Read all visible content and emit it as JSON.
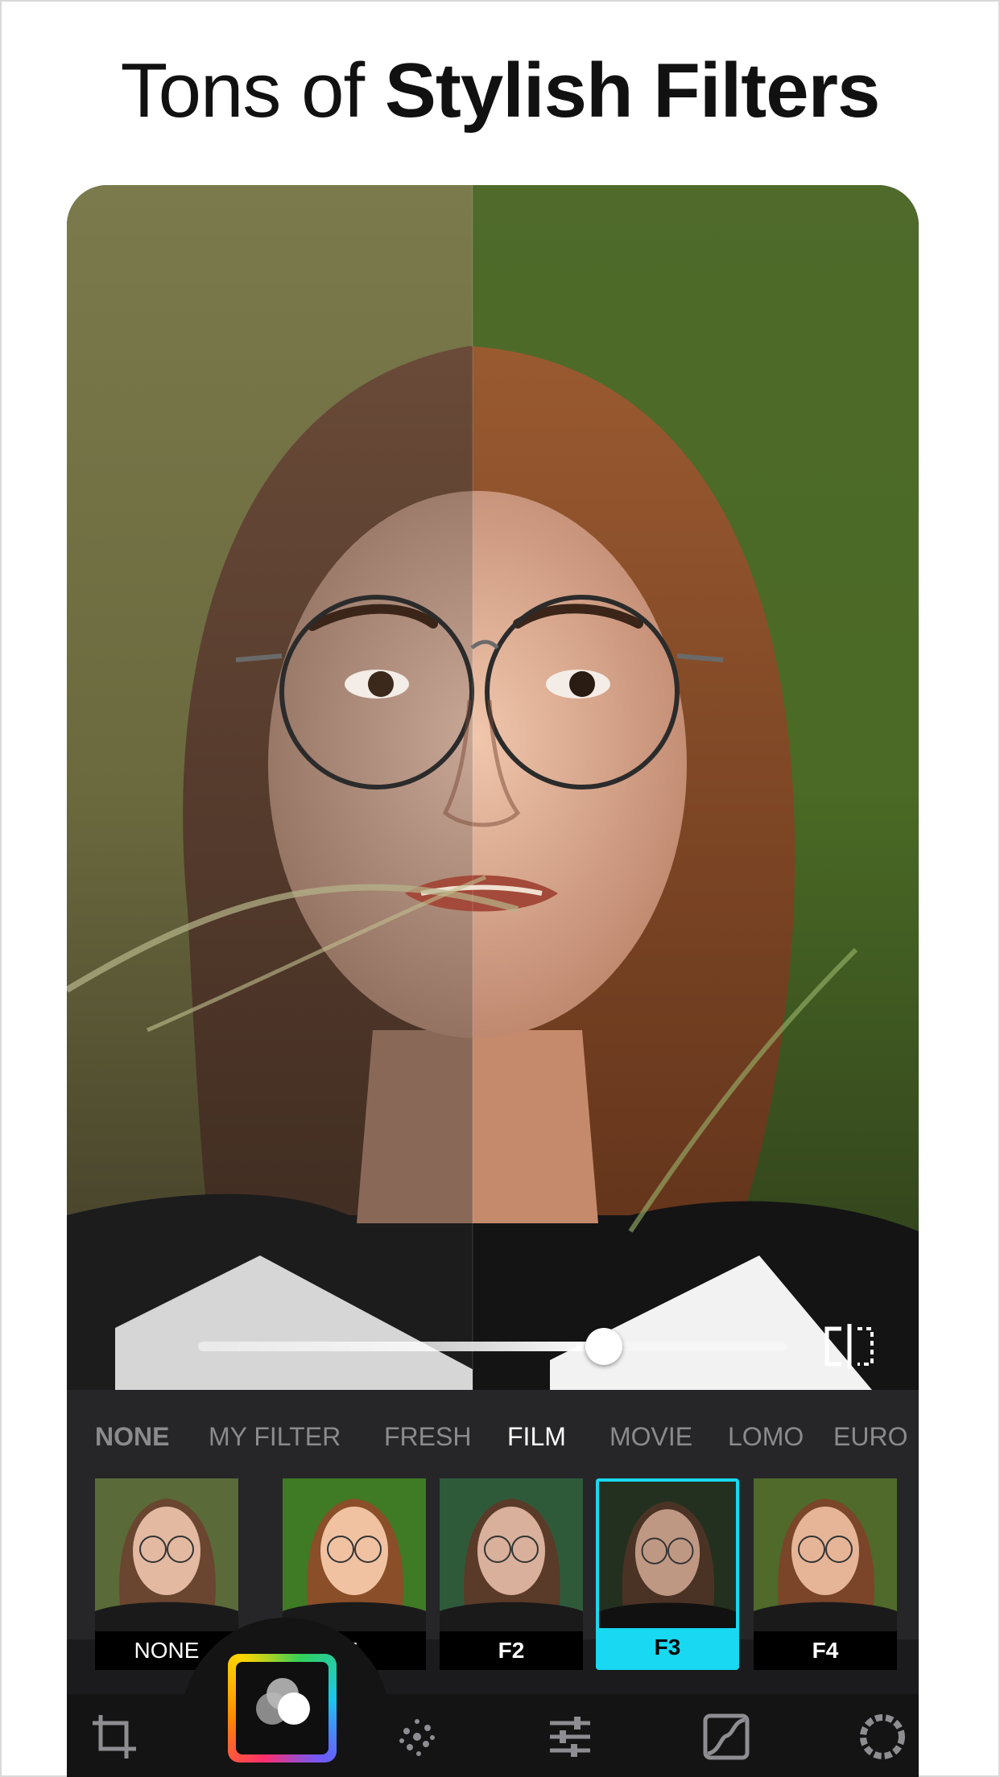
{
  "headline": {
    "part1": "Tons of ",
    "part2": "Stylish Filters"
  },
  "slider": {
    "value": 0.69
  },
  "categories": [
    {
      "label": "NONE"
    },
    {
      "label": "MY FILTER"
    },
    {
      "label": "FRESH"
    },
    {
      "label": "FILM"
    },
    {
      "label": "MOVIE"
    },
    {
      "label": "LOMO"
    },
    {
      "label": "EURO"
    }
  ],
  "selected_category": "FILM",
  "filters": [
    {
      "label": "NONE"
    },
    {
      "label": "1"
    },
    {
      "label": "F2"
    },
    {
      "label": "F3"
    },
    {
      "label": "F4"
    }
  ],
  "selected_filter": "F3",
  "toolbar": {
    "tools": [
      "crop-icon",
      "filter-icon",
      "effects-icon",
      "adjust-icon",
      "curves-icon",
      "vignette-icon"
    ]
  },
  "colors": {
    "accent": "#18d8f2",
    "panel": "#262628",
    "toolbar": "#141415"
  }
}
